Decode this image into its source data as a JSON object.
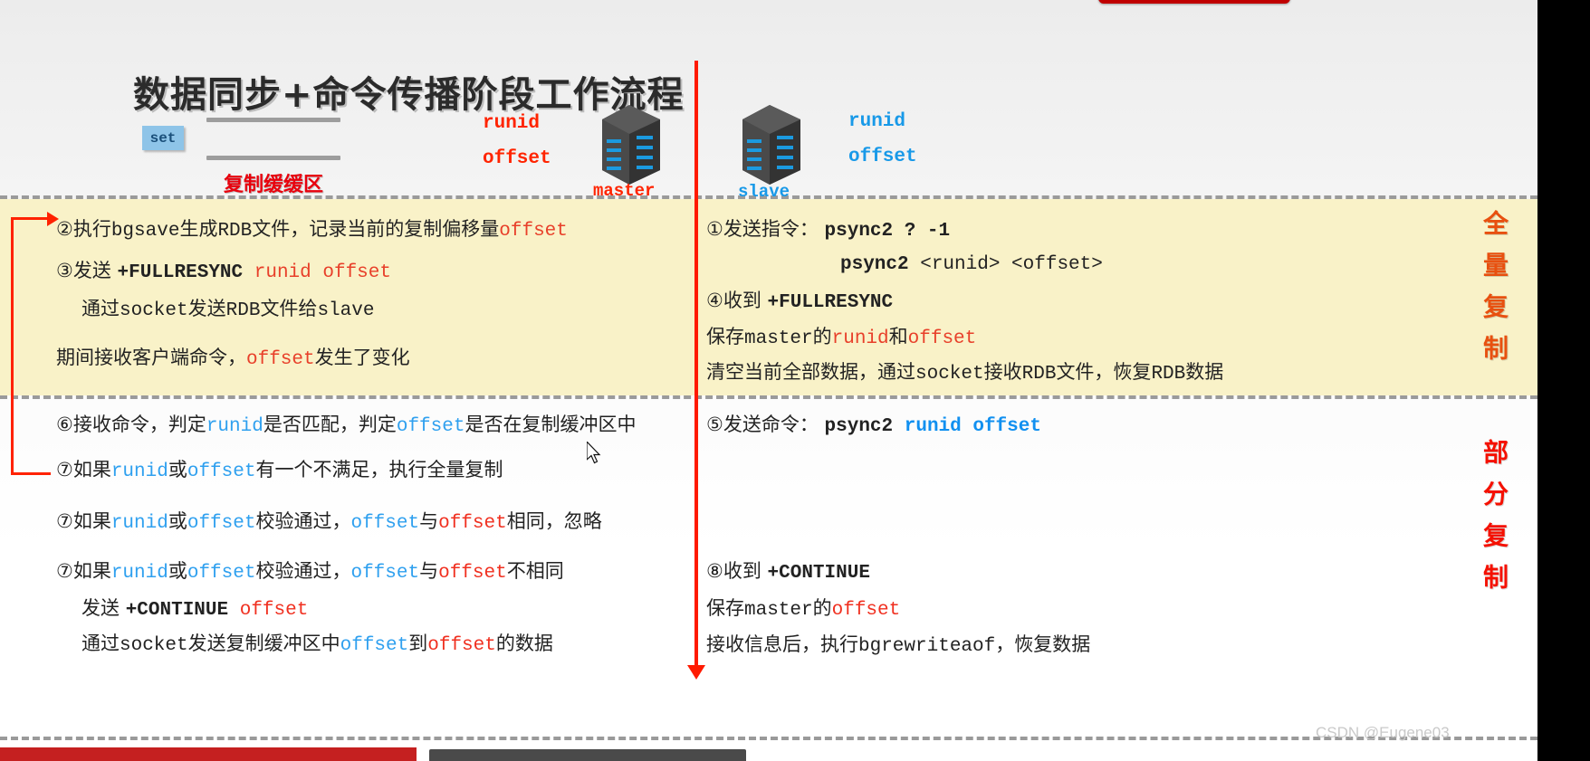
{
  "slide": {
    "title": "数据同步+命令传播阶段工作流程",
    "buffer": {
      "set_badge": "set",
      "label": "复制缓缓区"
    },
    "master": {
      "name": "master",
      "runid": "runid",
      "offset": "offset",
      "icon": "server-rack-icon"
    },
    "slave": {
      "name": "slave",
      "runid": "runid",
      "offset": "offset",
      "icon": "server-rack-icon"
    },
    "side_labels": {
      "full_replication": "全量复制",
      "partial_replication": "部分复制"
    },
    "master_column": {
      "full": [
        {
          "parts": [
            {
              "t": "②执行",
              "c": "dark",
              "mono": false
            },
            {
              "t": "bgsave",
              "c": "dark",
              "mono": true
            },
            {
              "t": "生成",
              "c": "dark",
              "mono": false
            },
            {
              "t": "RDB",
              "c": "dark",
              "mono": true
            },
            {
              "t": "文件，记录当前的复制偏移量",
              "c": "dark",
              "mono": false
            },
            {
              "t": "offset",
              "c": "red",
              "mono": true
            }
          ]
        },
        {
          "parts": [
            {
              "t": "③发送 ",
              "c": "dark",
              "mono": false
            },
            {
              "t": "+FULLRESYNC ",
              "c": "dark",
              "mono": true,
              "b": true
            },
            {
              "t": "runid offset",
              "c": "red",
              "mono": true
            }
          ]
        },
        {
          "indent": true,
          "parts": [
            {
              "t": "通过",
              "c": "dark",
              "mono": false
            },
            {
              "t": "socket",
              "c": "dark",
              "mono": true
            },
            {
              "t": "发送",
              "c": "dark",
              "mono": false
            },
            {
              "t": "RDB",
              "c": "dark",
              "mono": true
            },
            {
              "t": "文件给",
              "c": "dark",
              "mono": false
            },
            {
              "t": "slave",
              "c": "dark",
              "mono": true
            }
          ]
        },
        {
          "parts": [
            {
              "t": "期间接收客户端命令，",
              "c": "dark",
              "mono": false
            },
            {
              "t": "offset",
              "c": "red",
              "mono": true
            },
            {
              "t": "发生了变化",
              "c": "dark",
              "mono": false
            }
          ]
        }
      ],
      "partial": [
        {
          "parts": [
            {
              "t": "⑥接收命令，判定",
              "c": "dark",
              "mono": false
            },
            {
              "t": "runid",
              "c": "blue",
              "mono": true
            },
            {
              "t": "是否匹配，判定",
              "c": "dark",
              "mono": false
            },
            {
              "t": "offset",
              "c": "blue",
              "mono": true
            },
            {
              "t": "是否在复制缓冲区中",
              "c": "dark",
              "mono": false
            }
          ]
        },
        {
          "parts": [
            {
              "t": "⑦如果",
              "c": "dark",
              "mono": false
            },
            {
              "t": "runid",
              "c": "blue",
              "mono": true
            },
            {
              "t": "或",
              "c": "dark",
              "mono": false
            },
            {
              "t": "offset",
              "c": "blue",
              "mono": true
            },
            {
              "t": "有一个不满足，执行全量复制",
              "c": "dark",
              "mono": false
            }
          ]
        },
        {
          "parts": [
            {
              "t": "⑦如果",
              "c": "dark",
              "mono": false
            },
            {
              "t": "runid",
              "c": "blue",
              "mono": true
            },
            {
              "t": "或",
              "c": "dark",
              "mono": false
            },
            {
              "t": "offset",
              "c": "blue",
              "mono": true
            },
            {
              "t": "校验通过，",
              "c": "dark",
              "mono": false
            },
            {
              "t": "offset",
              "c": "blue",
              "mono": true
            },
            {
              "t": "与",
              "c": "dark",
              "mono": false
            },
            {
              "t": "offset",
              "c": "pured",
              "mono": true
            },
            {
              "t": "相同，忽略",
              "c": "dark",
              "mono": false
            }
          ]
        },
        {
          "parts": [
            {
              "t": "⑦如果",
              "c": "dark",
              "mono": false
            },
            {
              "t": "runid",
              "c": "blue",
              "mono": true
            },
            {
              "t": "或",
              "c": "dark",
              "mono": false
            },
            {
              "t": "offset",
              "c": "blue",
              "mono": true
            },
            {
              "t": "校验通过，",
              "c": "dark",
              "mono": false
            },
            {
              "t": "offset",
              "c": "blue",
              "mono": true
            },
            {
              "t": "与",
              "c": "dark",
              "mono": false
            },
            {
              "t": "offset",
              "c": "pured",
              "mono": true
            },
            {
              "t": "不相同",
              "c": "dark",
              "mono": false
            }
          ]
        },
        {
          "indent": true,
          "parts": [
            {
              "t": "发送 ",
              "c": "dark",
              "mono": false
            },
            {
              "t": "+CONTINUE ",
              "c": "dark",
              "mono": true,
              "b": true
            },
            {
              "t": "offset",
              "c": "pured",
              "mono": true
            }
          ]
        },
        {
          "indent": true,
          "parts": [
            {
              "t": "通过",
              "c": "dark",
              "mono": false
            },
            {
              "t": "socket",
              "c": "dark",
              "mono": true
            },
            {
              "t": "发送复制缓冲区中",
              "c": "dark",
              "mono": false
            },
            {
              "t": "offset",
              "c": "blue",
              "mono": true
            },
            {
              "t": "到",
              "c": "dark",
              "mono": false
            },
            {
              "t": "offset",
              "c": "pured",
              "mono": true
            },
            {
              "t": "的数据",
              "c": "dark",
              "mono": false
            }
          ]
        }
      ]
    },
    "slave_column": {
      "full": [
        {
          "parts": [
            {
              "t": "①发送指令： ",
              "c": "dark",
              "mono": false
            },
            {
              "t": "psync2  ? -1",
              "c": "dark",
              "mono": true,
              "b": true
            }
          ]
        },
        {
          "indent2": true,
          "parts": [
            {
              "t": "psync2  ",
              "c": "dark",
              "mono": true,
              "b": true
            },
            {
              "t": "<runid> <offset>",
              "c": "dark",
              "mono": true
            }
          ]
        },
        {
          "parts": [
            {
              "t": "④收到 ",
              "c": "dark",
              "mono": false
            },
            {
              "t": "+FULLRESYNC",
              "c": "dark",
              "mono": true,
              "b": true
            }
          ]
        },
        {
          "parts": [
            {
              "t": "保存",
              "c": "dark",
              "mono": false
            },
            {
              "t": "master",
              "c": "dark",
              "mono": true
            },
            {
              "t": "的",
              "c": "dark",
              "mono": false
            },
            {
              "t": "runid",
              "c": "red",
              "mono": true
            },
            {
              "t": "和",
              "c": "dark",
              "mono": false
            },
            {
              "t": "offset",
              "c": "red",
              "mono": true
            }
          ]
        },
        {
          "parts": [
            {
              "t": "清空当前全部数据，通过",
              "c": "dark",
              "mono": false
            },
            {
              "t": "socket",
              "c": "dark",
              "mono": true
            },
            {
              "t": "接收",
              "c": "dark",
              "mono": false
            },
            {
              "t": "RDB",
              "c": "dark",
              "mono": true
            },
            {
              "t": "文件，恢复",
              "c": "dark",
              "mono": false
            },
            {
              "t": "RDB",
              "c": "dark",
              "mono": true
            },
            {
              "t": "数据",
              "c": "dark",
              "mono": false
            }
          ]
        }
      ],
      "partial": [
        {
          "parts": [
            {
              "t": "⑤发送命令： ",
              "c": "dark",
              "mono": false
            },
            {
              "t": "psync2  ",
              "c": "dark",
              "mono": true,
              "b": true
            },
            {
              "t": "runid offset",
              "c": "pureblue",
              "mono": true,
              "b": true
            }
          ]
        },
        {
          "parts": [
            {
              "t": "⑧收到 ",
              "c": "dark",
              "mono": false
            },
            {
              "t": "+CONTINUE",
              "c": "dark",
              "mono": true,
              "b": true
            }
          ]
        },
        {
          "parts": [
            {
              "t": "保存",
              "c": "dark",
              "mono": false
            },
            {
              "t": "master",
              "c": "dark",
              "mono": true
            },
            {
              "t": "的",
              "c": "dark",
              "mono": false
            },
            {
              "t": "offset",
              "c": "pured",
              "mono": true
            }
          ]
        },
        {
          "parts": [
            {
              "t": "接收信息后，执行",
              "c": "dark",
              "mono": false
            },
            {
              "t": "bgrewriteaof",
              "c": "dark",
              "mono": true
            },
            {
              "t": "，恢复数据",
              "c": "dark",
              "mono": false
            }
          ]
        }
      ]
    },
    "watermark": "CSDN @Eugene03",
    "colors": {
      "accent_red": "#ff2400",
      "accent_blue": "#1899e8",
      "band_yellow": "#f9f2c8",
      "divider_red": "#ff1a00",
      "full_label": "#e8500f",
      "part_label": "#f51000"
    }
  }
}
